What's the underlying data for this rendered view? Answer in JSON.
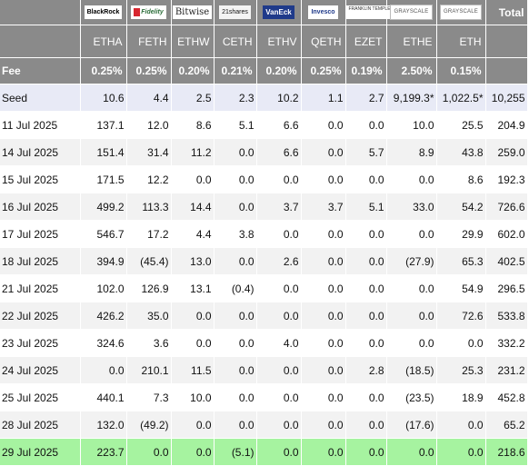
{
  "columns": [
    {
      "issuer_logo": "BlackRock",
      "logo_icon": "blackrock-logo-icon",
      "ticker": "ETHA",
      "fee": "0.25%"
    },
    {
      "issuer_logo": "Fidelity",
      "logo_icon": "fidelity-logo-icon",
      "ticker": "FETH",
      "fee": "0.25%"
    },
    {
      "issuer_logo": "Bitwise",
      "logo_icon": "bitwise-logo-icon",
      "ticker": "ETHW",
      "fee": "0.20%"
    },
    {
      "issuer_logo": "21shares",
      "logo_icon": "21shares-logo-icon",
      "ticker": "CETH",
      "fee": "0.21%"
    },
    {
      "issuer_logo": "VanEck",
      "logo_icon": "vaneck-logo-icon",
      "ticker": "ETHV",
      "fee": "0.20%"
    },
    {
      "issuer_logo": "Invesco",
      "logo_icon": "invesco-logo-icon",
      "ticker": "QETH",
      "fee": "0.25%"
    },
    {
      "issuer_logo": "FRANKLIN TEMPLETON",
      "logo_icon": "franklin-templeton-logo-icon",
      "ticker": "EZET",
      "fee": "0.19%"
    },
    {
      "issuer_logo": "GRAYSCALE",
      "logo_icon": "grayscale-logo-icon",
      "ticker": "ETHE",
      "fee": "2.50%"
    },
    {
      "issuer_logo": "GRAYSCALE",
      "logo_icon": "grayscale-logo-icon",
      "ticker": "ETH",
      "fee": "0.15%"
    }
  ],
  "total_label": "Total",
  "fee_label": "Fee",
  "rows": [
    {
      "label": "Seed",
      "values": [
        "10.6",
        "4.4",
        "2.5",
        "2.3",
        "10.2",
        "1.1",
        "2.7",
        "9,199.3*",
        "1,022.5*"
      ],
      "total": "10,255"
    },
    {
      "label": "11 Jul 2025",
      "values": [
        "137.1",
        "12.0",
        "8.6",
        "5.1",
        "6.6",
        "0.0",
        "0.0",
        "10.0",
        "25.5"
      ],
      "total": "204.9"
    },
    {
      "label": "14 Jul 2025",
      "values": [
        "151.4",
        "31.4",
        "11.2",
        "0.0",
        "6.6",
        "0.0",
        "5.7",
        "8.9",
        "43.8"
      ],
      "total": "259.0"
    },
    {
      "label": "15 Jul 2025",
      "values": [
        "171.5",
        "12.2",
        "0.0",
        "0.0",
        "0.0",
        "0.0",
        "0.0",
        "0.0",
        "8.6"
      ],
      "total": "192.3"
    },
    {
      "label": "16 Jul 2025",
      "values": [
        "499.2",
        "113.3",
        "14.4",
        "0.0",
        "3.7",
        "3.7",
        "5.1",
        "33.0",
        "54.2"
      ],
      "total": "726.6"
    },
    {
      "label": "17 Jul 2025",
      "values": [
        "546.7",
        "17.2",
        "4.4",
        "3.8",
        "0.0",
        "0.0",
        "0.0",
        "0.0",
        "29.9"
      ],
      "total": "602.0"
    },
    {
      "label": "18 Jul 2025",
      "values": [
        "394.9",
        "(45.4)",
        "13.0",
        "0.0",
        "2.6",
        "0.0",
        "0.0",
        "(27.9)",
        "65.3"
      ],
      "total": "402.5"
    },
    {
      "label": "21 Jul 2025",
      "values": [
        "102.0",
        "126.9",
        "13.1",
        "(0.4)",
        "0.0",
        "0.0",
        "0.0",
        "0.0",
        "54.9"
      ],
      "total": "296.5"
    },
    {
      "label": "22 Jul 2025",
      "values": [
        "426.2",
        "35.0",
        "0.0",
        "0.0",
        "0.0",
        "0.0",
        "0.0",
        "0.0",
        "72.6"
      ],
      "total": "533.8"
    },
    {
      "label": "23 Jul 2025",
      "values": [
        "324.6",
        "3.6",
        "0.0",
        "0.0",
        "4.0",
        "0.0",
        "0.0",
        "0.0",
        "0.0"
      ],
      "total": "332.2"
    },
    {
      "label": "24 Jul 2025",
      "values": [
        "0.0",
        "210.1",
        "11.5",
        "0.0",
        "0.0",
        "0.0",
        "2.8",
        "(18.5)",
        "25.3"
      ],
      "total": "231.2"
    },
    {
      "label": "25 Jul 2025",
      "values": [
        "440.1",
        "7.3",
        "10.0",
        "0.0",
        "0.0",
        "0.0",
        "0.0",
        "(23.5)",
        "18.9"
      ],
      "total": "452.8"
    },
    {
      "label": "28 Jul 2025",
      "values": [
        "132.0",
        "(49.2)",
        "0.0",
        "0.0",
        "0.0",
        "0.0",
        "0.0",
        "(17.6)",
        "0.0"
      ],
      "total": "65.2"
    },
    {
      "label": "29 Jul 2025",
      "values": [
        "223.7",
        "0.0",
        "0.0",
        "(5.1)",
        "0.0",
        "0.0",
        "0.0",
        "0.0",
        "0.0"
      ],
      "total": "218.6"
    }
  ],
  "colors": {
    "header_bg": "#8a8a8a",
    "seed_row_bg": "#e8eaf6",
    "alt_row_bg": "#f2f2f2",
    "latest_row_bg": "#a6f3a0",
    "negative_text": "#e0201c"
  }
}
